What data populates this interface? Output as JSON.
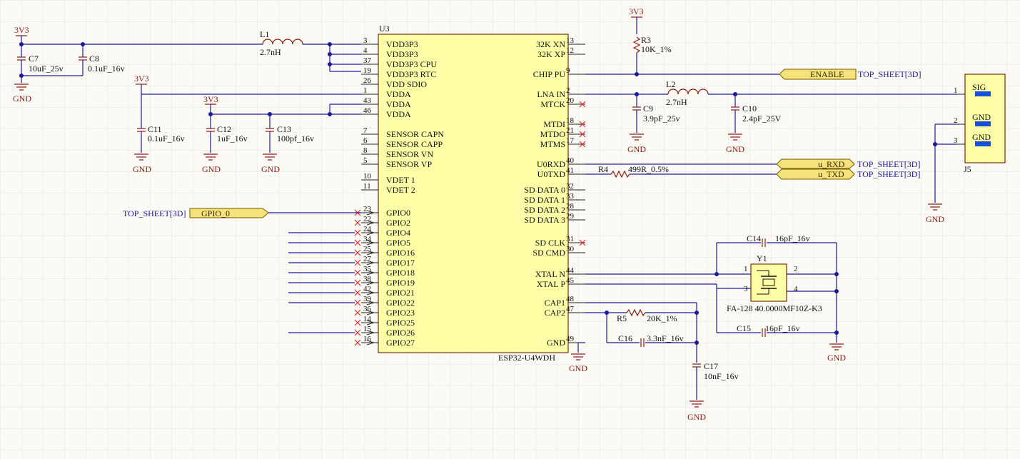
{
  "colors": {
    "wire": "#1b1b9c",
    "component_body": "#ffffa8",
    "net_port": "#f4e27a",
    "power_label": "#8a1c10",
    "no_connect": "#e03030",
    "grid": "#e8e4d6"
  },
  "ic": {
    "designator": "U3",
    "part": "ESP32-U4WDH",
    "left_pins": [
      {
        "num": "3",
        "name": "VDD3P3"
      },
      {
        "num": "4",
        "name": "VDD3P3"
      },
      {
        "num": "37",
        "name": "VDD3P3 CPU"
      },
      {
        "num": "19",
        "name": "VDD3P3 RTC"
      },
      {
        "num": "26",
        "name": "VDD SDIO"
      },
      {
        "num": "1",
        "name": "VDDA"
      },
      {
        "num": "43",
        "name": "VDDA"
      },
      {
        "num": "46",
        "name": "VDDA"
      },
      {
        "num": "7",
        "name": "SENSOR CAPN"
      },
      {
        "num": "6",
        "name": "SENSOR CAPP"
      },
      {
        "num": "8",
        "name": "SENSOR VN"
      },
      {
        "num": "5",
        "name": "SENSOR VP"
      },
      {
        "num": "10",
        "name": "VDET 1"
      },
      {
        "num": "11",
        "name": "VDET 2"
      },
      {
        "num": "23",
        "name": "GPIO0"
      },
      {
        "num": "22",
        "name": "GPIO2"
      },
      {
        "num": "24",
        "name": "GPIO4"
      },
      {
        "num": "34",
        "name": "GPIO5"
      },
      {
        "num": "25",
        "name": "GPIO16"
      },
      {
        "num": "27",
        "name": "GPIO17"
      },
      {
        "num": "35",
        "name": "GPIO18"
      },
      {
        "num": "38",
        "name": "GPIO19"
      },
      {
        "num": "42",
        "name": "GPIO21"
      },
      {
        "num": "39",
        "name": "GPIO22"
      },
      {
        "num": "36",
        "name": "GPIO23"
      },
      {
        "num": "14",
        "name": "GPIO25"
      },
      {
        "num": "15",
        "name": "GPIO26"
      },
      {
        "num": "16",
        "name": "GPIO27"
      }
    ],
    "right_pins": [
      {
        "num": "13",
        "name": "32K XN"
      },
      {
        "num": "12",
        "name": "32K XP"
      },
      {
        "num": "9",
        "name": "CHIP PU"
      },
      {
        "num": "2",
        "name": "LNA IN"
      },
      {
        "num": "20",
        "name": "MTCK"
      },
      {
        "num": "18",
        "name": "MTDI"
      },
      {
        "num": "21",
        "name": "MTDO"
      },
      {
        "num": "17",
        "name": "MTMS"
      },
      {
        "num": "40",
        "name": "U0RXD"
      },
      {
        "num": "41",
        "name": "U0TXD"
      },
      {
        "num": "32",
        "name": "SD DATA 0"
      },
      {
        "num": "33",
        "name": "SD DATA 1"
      },
      {
        "num": "28",
        "name": "SD DATA 2"
      },
      {
        "num": "29",
        "name": "SD DATA 3"
      },
      {
        "num": "31",
        "name": "SD CLK"
      },
      {
        "num": "30",
        "name": "SD CMD"
      },
      {
        "num": "44",
        "name": "XTAL N"
      },
      {
        "num": "45",
        "name": "XTAL P"
      },
      {
        "num": "48",
        "name": "CAP1"
      },
      {
        "num": "47",
        "name": "CAP2"
      },
      {
        "num": "49",
        "name": "GND"
      }
    ]
  },
  "power": {
    "vcc": "3V3",
    "gnd": "GND"
  },
  "components": {
    "c7": {
      "ref": "C7",
      "value": "10uF_25v"
    },
    "c8": {
      "ref": "C8",
      "value": "0.1uF_16v"
    },
    "l1": {
      "ref": "L1",
      "value": "2.7nH"
    },
    "c11": {
      "ref": "C11",
      "value": "0.1uF_16v"
    },
    "c12": {
      "ref": "C12",
      "value": "1uF_16v"
    },
    "c13": {
      "ref": "C13",
      "value": "100pf_16v"
    },
    "r3": {
      "ref": "R3",
      "value": "10K_1%"
    },
    "l2": {
      "ref": "L2",
      "value": "2.7nH"
    },
    "c9": {
      "ref": "C9",
      "value": "3.9pF_25v"
    },
    "c10": {
      "ref": "C10",
      "value": "2.4pF_25V"
    },
    "r4": {
      "ref": "R4",
      "value": "499R_0.5%"
    },
    "c14": {
      "ref": "C14",
      "value": "16pF_16v"
    },
    "c15": {
      "ref": "C15",
      "value": "16pF_16v"
    },
    "y1": {
      "ref": "Y1",
      "value": "FA-128 40.0000MF10Z-K3",
      "pins": [
        "1",
        "2",
        "3",
        "4"
      ]
    },
    "r5": {
      "ref": "R5",
      "value": "20K_1%"
    },
    "c16": {
      "ref": "C16",
      "value": "3.3nF_16v"
    },
    "c17": {
      "ref": "C17",
      "value": "10nF_16v"
    },
    "j5": {
      "ref": "J5",
      "pins": [
        {
          "num": "1",
          "name": "SIG"
        },
        {
          "num": "2",
          "name": "GND"
        },
        {
          "num": "3",
          "name": "GND"
        }
      ]
    }
  },
  "ports": {
    "enable": {
      "net": "ENABLE",
      "sheet": "TOP_SHEET[3D]"
    },
    "urxd": {
      "net": "u_RXD",
      "sheet": "TOP_SHEET[3D]"
    },
    "utxd": {
      "net": "u_TXD",
      "sheet": "TOP_SHEET[3D]"
    },
    "gpio0": {
      "net": "GPIO_0",
      "sheet": "TOP_SHEET[3D]"
    }
  }
}
